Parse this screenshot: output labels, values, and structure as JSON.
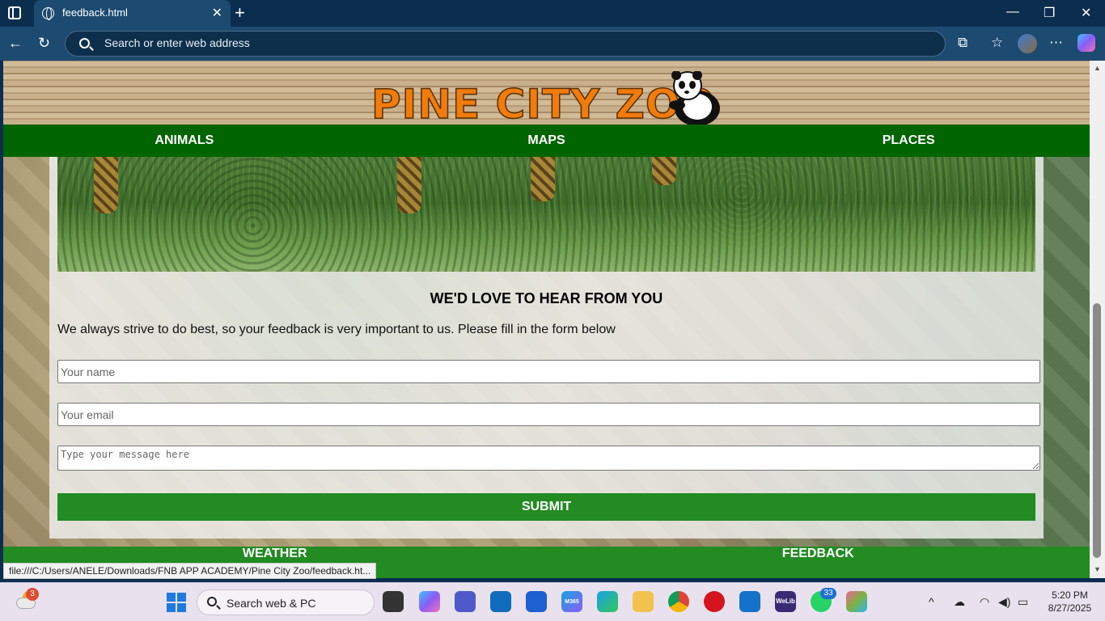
{
  "browser": {
    "tab_title": "feedback.html",
    "address_placeholder": "Search or enter web address",
    "status_url": "file:///C:/Users/ANELE/Downloads/FNB APP ACADEMY/Pine City Zoo/feedback.ht..."
  },
  "site": {
    "logo_text": "PINE CITY ZOO",
    "top_nav": [
      "ANIMALS",
      "MAPS",
      "PLACES"
    ],
    "bottom_nav": [
      "WEATHER",
      "FEEDBACK"
    ]
  },
  "form": {
    "heading": "WE'D LOVE TO HEAR FROM YOU",
    "intro": "We always strive to do best, so your feedback is very important to us. Please fill in the form below",
    "name_placeholder": "Your name",
    "email_placeholder": "Your email",
    "message_placeholder": "Type your message here",
    "submit_label": "SUBMIT"
  },
  "taskbar": {
    "weather_badge": "3",
    "search_placeholder": "Search web & PC",
    "welib_label": "WeLib",
    "m365_label": "M365",
    "whatsapp_badge": "33",
    "time": "5:20 PM",
    "date": "8/27/2025"
  },
  "colors": {
    "nav_green": "#006400",
    "accent_green": "#228b22",
    "logo_orange": "#f07c0c",
    "browser_dark": "#0b2e4f"
  }
}
